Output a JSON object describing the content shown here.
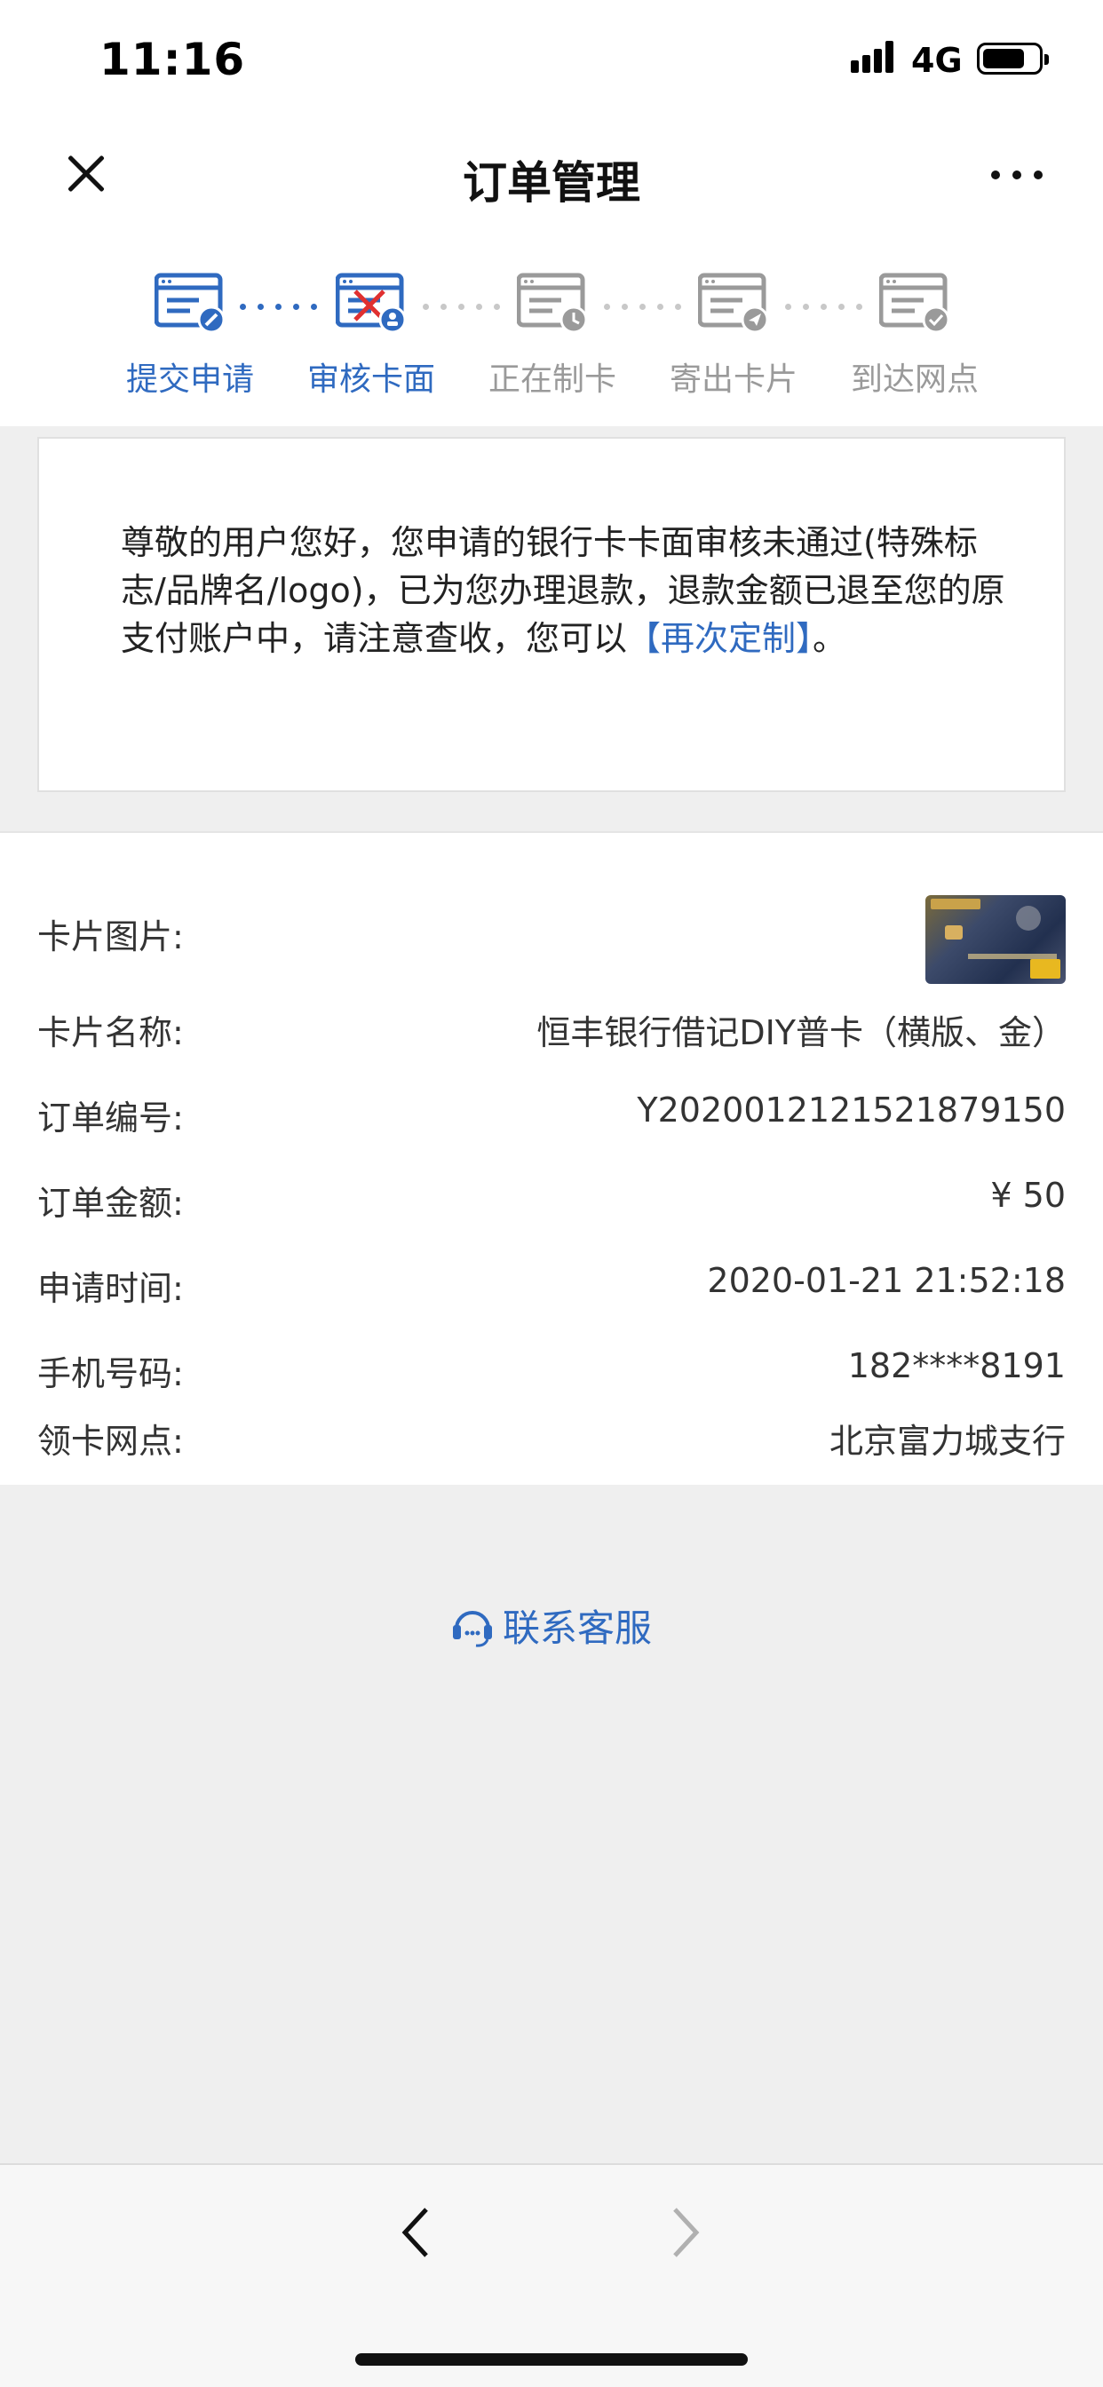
{
  "status_bar": {
    "time": "11:16",
    "network": "4G"
  },
  "nav": {
    "title": "订单管理"
  },
  "steps": [
    {
      "label": "提交申请",
      "state": "done",
      "icon": "form-edit-icon"
    },
    {
      "label": "审核卡面",
      "state": "failed",
      "icon": "form-review-failed-icon"
    },
    {
      "label": "正在制卡",
      "state": "pending",
      "icon": "form-clock-icon"
    },
    {
      "label": "寄出卡片",
      "state": "pending",
      "icon": "form-send-icon"
    },
    {
      "label": "到达网点",
      "state": "pending",
      "icon": "form-check-icon"
    }
  ],
  "notice": {
    "text": "尊敬的用户您好，您申请的银行卡卡面审核未通过(特殊标志/品牌名/logo)，已为您办理退款，退款金额已退至您的原支付账户中，请注意查收，您可以",
    "link": "【再次定制】",
    "suffix": "。"
  },
  "details": {
    "card_image_label": "卡片图片:",
    "card_name_label": "卡片名称:",
    "card_name": "恒丰银行借记DIY普卡（横版、金）",
    "order_no_label": "订单编号:",
    "order_no": "Y2020012121521879150",
    "amount_label": "订单金额:",
    "amount": "¥ 50",
    "time_label": "申请时间:",
    "time": "2020-01-21 21:52:18",
    "phone_label": "手机号码:",
    "phone": "182****8191",
    "branch_label": "领卡网点:",
    "branch": "北京富力城支行"
  },
  "contact": {
    "label": "联系客服"
  },
  "colors": {
    "accent": "#2f6ac0",
    "inactive": "#9a9a9a",
    "error": "#e03030"
  }
}
